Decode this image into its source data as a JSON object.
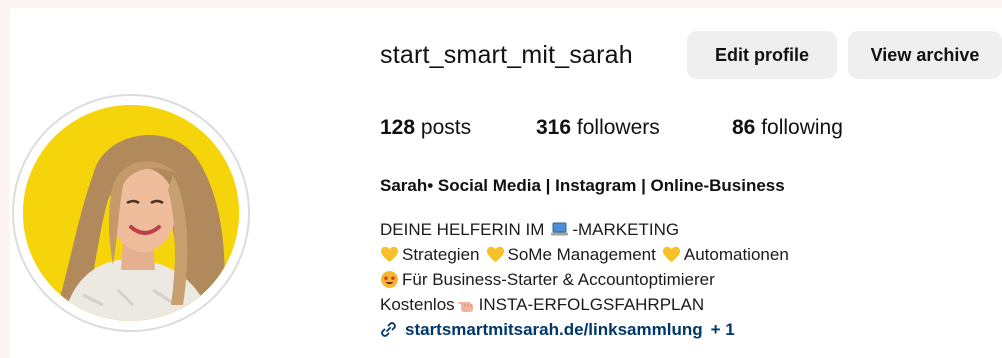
{
  "profile": {
    "username": "start_smart_mit_sarah",
    "buttons": {
      "edit_profile": "Edit profile",
      "view_archive": "View archive"
    },
    "stats": {
      "posts_count": "128",
      "posts_label": "posts",
      "followers_count": "316",
      "followers_label": "followers",
      "following_count": "86",
      "following_label": "following"
    },
    "full_name": "Sarah• Social Media | Instagram | Online-Business",
    "bio": {
      "line1_before": "DEINE HELFERIN IM",
      "line1_icon": "laptop-emoji",
      "line1_after": "-MARKETING",
      "line2_items": [
        "Strategien",
        "SoMe Management",
        "Automationen"
      ],
      "line2_icon": "yellow-heart-emoji",
      "line3_icon": "star-struck-emoji",
      "line3_text": "Für Business-Starter & Accountoptimierer",
      "line4_before": "Kostenlos",
      "line4_icon": "pointing-hand-emoji",
      "line4_after": "INSTA-ERFOLGSFAHRPLAN"
    },
    "link": {
      "icon": "link-icon",
      "text": "startsmartmitsarah.de/linksammlung",
      "more": "+ 1"
    }
  },
  "colors": {
    "page_background": "#fcf5f1",
    "button_background": "#efefef",
    "link_color": "#00376b",
    "avatar_background": "#f6d40c"
  }
}
